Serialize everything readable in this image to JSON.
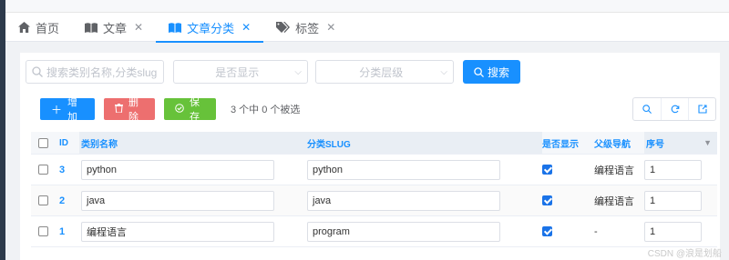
{
  "tabs": [
    {
      "label": "首页",
      "icon": "home-icon",
      "closable": false
    },
    {
      "label": "文章",
      "icon": "book-icon",
      "closable": true
    },
    {
      "label": "文章分类",
      "icon": "book-open-icon",
      "closable": true,
      "active": true
    },
    {
      "label": "标签",
      "icon": "tag-icon",
      "closable": true
    }
  ],
  "filters": {
    "search_placeholder": "搜索类别名称,分类slug",
    "show_placeholder": "是否显示",
    "level_placeholder": "分类层级",
    "search_button": "搜索"
  },
  "actions": {
    "add": "增加",
    "delete": "删除",
    "save": "保存",
    "selection_info": "3 个中 0 个被选"
  },
  "table": {
    "headers": {
      "id": "ID",
      "name": "类别名称",
      "slug": "分类SLUG",
      "show": "是否显示",
      "parent": "父级导航",
      "seq": "序号"
    },
    "rows": [
      {
        "id": "3",
        "name": "python",
        "slug": "python",
        "show": true,
        "parent": "编程语言",
        "seq": "1"
      },
      {
        "id": "2",
        "name": "java",
        "slug": "java",
        "show": true,
        "parent": "编程语言",
        "seq": "1"
      },
      {
        "id": "1",
        "name": "编程语言",
        "slug": "program",
        "show": true,
        "parent": "-",
        "seq": "1"
      }
    ]
  },
  "watermark": "CSDN @浪是划船",
  "colors": {
    "primary": "#1890ff",
    "danger": "#ed6f6f",
    "success": "#67c23a"
  }
}
